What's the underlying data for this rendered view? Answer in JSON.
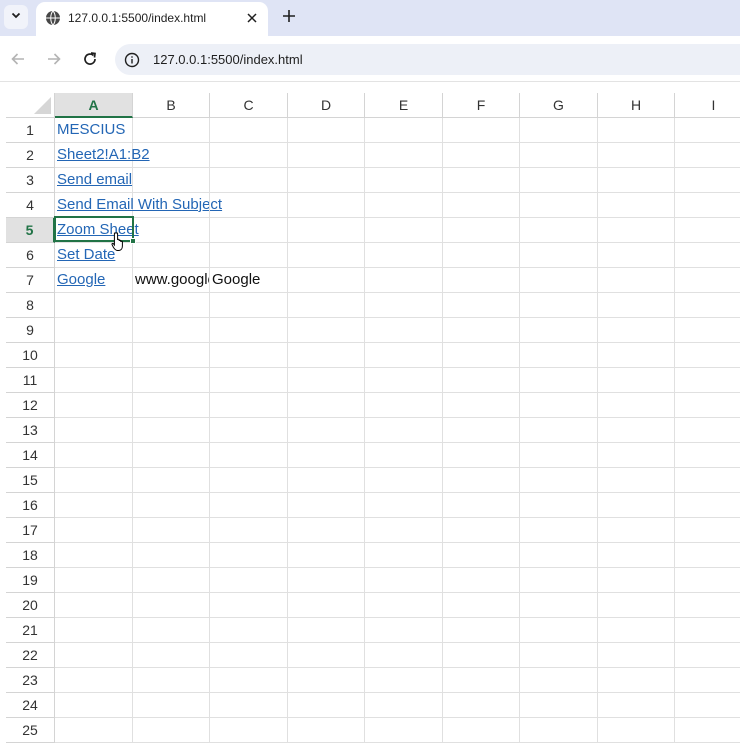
{
  "browser": {
    "tab_title": "127.0.0.1:5500/index.html",
    "url": "127.0.0.1:5500/index.html",
    "icons": {
      "tab_menu": "chevron-down-icon",
      "favicon": "globe-icon",
      "close": "close-icon",
      "new_tab": "plus-icon",
      "back": "arrow-left-icon",
      "forward": "arrow-right-icon",
      "reload": "reload-icon",
      "site_info": "info-icon"
    }
  },
  "sheet": {
    "columns": [
      "A",
      "B",
      "C",
      "D",
      "E",
      "F",
      "G",
      "H",
      "I"
    ],
    "rows": [
      "1",
      "2",
      "3",
      "4",
      "5",
      "6",
      "7",
      "8",
      "9",
      "10",
      "11",
      "12",
      "13",
      "14",
      "15",
      "16",
      "17",
      "18",
      "19",
      "20",
      "21",
      "22",
      "23",
      "24",
      "25"
    ],
    "active_cell": "A5",
    "active_column": "A",
    "active_row": "5",
    "cells": {
      "A1": "MESCIUS",
      "A2": "Sheet2!A1:B2",
      "A3": "Send email",
      "A4": "Send Email With Subject",
      "A5": "Zoom Sheet",
      "A6": "Set Date",
      "A7": "Google",
      "B7": "www.google.com",
      "C7": "Google"
    },
    "colors": {
      "accent": "#217346",
      "link": "#2366b5",
      "gridline": "#e0e0e0"
    }
  }
}
